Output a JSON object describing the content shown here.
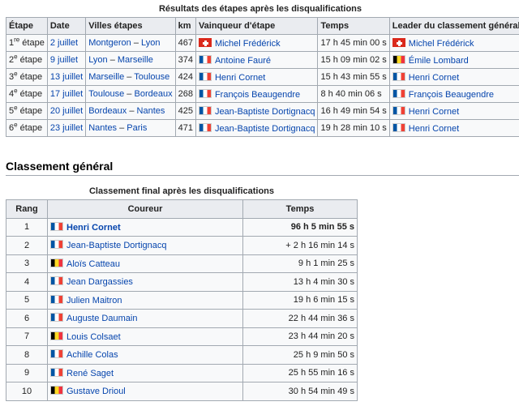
{
  "stages_table": {
    "caption": "Résultats des étapes après les disqualifications",
    "headers": [
      "Étape",
      "Date",
      "Villes étapes",
      "km",
      "Vainqueur d'étape",
      "Temps",
      "Leader du classement général"
    ],
    "rows": [
      {
        "num": "1",
        "sup": "re",
        "suffix": " étape",
        "date": "2 juillet",
        "from": "Montgeron",
        "to": "Lyon",
        "km": "467",
        "winner": "Michel Frédérick",
        "winner_flag": "ch",
        "time": "17 h 45 min 00 s",
        "leader": "Michel Frédérick",
        "leader_flag": "ch"
      },
      {
        "num": "2",
        "sup": "e",
        "suffix": " étape",
        "date": "9 juillet",
        "from": "Lyon",
        "to": "Marseille",
        "km": "374",
        "winner": "Antoine Fauré",
        "winner_flag": "fr",
        "time": "15 h 09 min 02 s",
        "leader": "Émile Lombard",
        "leader_flag": "be"
      },
      {
        "num": "3",
        "sup": "e",
        "suffix": " étape",
        "date": "13 juillet",
        "from": "Marseille",
        "to": "Toulouse",
        "km": "424",
        "winner": "Henri Cornet",
        "winner_flag": "fr",
        "time": "15 h 43 min 55 s",
        "leader": "Henri Cornet",
        "leader_flag": "fr"
      },
      {
        "num": "4",
        "sup": "e",
        "suffix": " étape",
        "date": "17 juillet",
        "from": "Toulouse",
        "to": "Bordeaux",
        "km": "268",
        "winner": "François Beaugendre",
        "winner_flag": "fr",
        "time": "8 h 40 min 06 s",
        "leader": "François Beaugendre",
        "leader_flag": "fr"
      },
      {
        "num": "5",
        "sup": "e",
        "suffix": " étape",
        "date": "20 juillet",
        "from": "Bordeaux",
        "to": "Nantes",
        "km": "425",
        "winner": "Jean-Baptiste Dortignacq",
        "winner_flag": "fr",
        "time": "16 h 49 min 54 s",
        "leader": "Henri Cornet",
        "leader_flag": "fr"
      },
      {
        "num": "6",
        "sup": "e",
        "suffix": " étape",
        "date": "23 juillet",
        "from": "Nantes",
        "to": "Paris",
        "km": "471",
        "winner": "Jean-Baptiste Dortignacq",
        "winner_flag": "fr",
        "time": "19 h 28 min 10 s",
        "leader": "Henri Cornet",
        "leader_flag": "fr"
      }
    ]
  },
  "section_heading": "Classement général",
  "gc_table": {
    "caption": "Classement final après les disqualifications",
    "headers": [
      "Rang",
      "Coureur",
      "Temps"
    ],
    "rows": [
      {
        "rank": "1",
        "rider": "Henri Cornet",
        "flag": "fr",
        "time": "96 h 5 min 55 s",
        "bold": true
      },
      {
        "rank": "2",
        "rider": "Jean-Baptiste Dortignacq",
        "flag": "fr",
        "time": "+ 2 h 16 min 14 s"
      },
      {
        "rank": "3",
        "rider": "Aloïs Catteau",
        "flag": "be",
        "time": "9 h 1 min 25 s"
      },
      {
        "rank": "4",
        "rider": "Jean Dargassies",
        "flag": "fr",
        "time": "13 h 4 min 30 s"
      },
      {
        "rank": "5",
        "rider": "Julien Maitron",
        "flag": "fr",
        "time": "19 h 6 min 15 s"
      },
      {
        "rank": "6",
        "rider": "Auguste Daumain",
        "flag": "fr",
        "time": "22 h 44 min 36 s"
      },
      {
        "rank": "7",
        "rider": "Louis Colsaet",
        "flag": "be",
        "time": "23 h 44 min 20 s"
      },
      {
        "rank": "8",
        "rider": "Achille Colas",
        "flag": "fr",
        "time": "25 h 9 min 50 s"
      },
      {
        "rank": "9",
        "rider": "René Saget",
        "flag": "fr",
        "time": "25 h 55 min 16 s"
      },
      {
        "rank": "10",
        "rider": "Gustave Drioul",
        "flag": "be",
        "time": "30 h 54 min 49 s"
      }
    ]
  }
}
